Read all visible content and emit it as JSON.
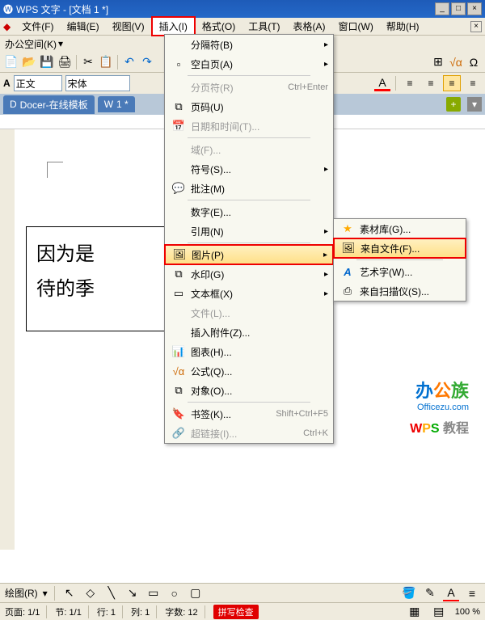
{
  "title": "WPS 文字 - [文档 1 *]",
  "menubar": {
    "file": "文件(F)",
    "edit": "编辑(E)",
    "view": "视图(V)",
    "insert": "插入(I)",
    "format": "格式(O)",
    "tools": "工具(T)",
    "table": "表格(A)",
    "window": "窗口(W)",
    "help": "帮助(H)"
  },
  "workspace": "办公空间(K)",
  "format_bar": {
    "style": "正文",
    "font": "宋体"
  },
  "tabs": {
    "docer": "Docer-在线模板",
    "doc1": "1 *"
  },
  "insert_menu": {
    "separator": "分隔符(B)",
    "blank_page": "空白页(A)",
    "page_break": "分页符(R)",
    "page_break_key": "Ctrl+Enter",
    "page_number": "页码(U)",
    "datetime": "日期和时间(T)...",
    "field": "域(F)...",
    "symbol": "符号(S)...",
    "comment": "批注(M)",
    "number": "数字(E)...",
    "reference": "引用(N)",
    "picture": "图片(P)",
    "watermark": "水印(G)",
    "textbox": "文本框(X)",
    "file": "文件(L)...",
    "attachment": "插入附件(Z)...",
    "chart": "图表(H)...",
    "formula": "公式(Q)...",
    "object": "对象(O)...",
    "bookmark": "书签(K)...",
    "bookmark_key": "Shift+Ctrl+F5",
    "hyperlink": "超链接(I)...",
    "hyperlink_key": "Ctrl+K"
  },
  "picture_submenu": {
    "gallery": "素材库(G)...",
    "from_file": "来自文件(F)...",
    "wordart": "艺术字(W)...",
    "from_scanner": "来自扫描仪(S)..."
  },
  "document_text": {
    "line1": "因为是",
    "line2": "待的季"
  },
  "watermark_text": {
    "brand": "办公族",
    "url": "Officezu.com",
    "wps": "WPS",
    "tutorial": "教程"
  },
  "draw_bar": {
    "label": "绘图(R)"
  },
  "status": {
    "page": "页面: 1/1",
    "section": "节: 1/1",
    "line": "行: 1",
    "col": "列: 1",
    "chars": "字数: 12",
    "spellcheck": "拼写检查",
    "zoom": "100 %"
  }
}
